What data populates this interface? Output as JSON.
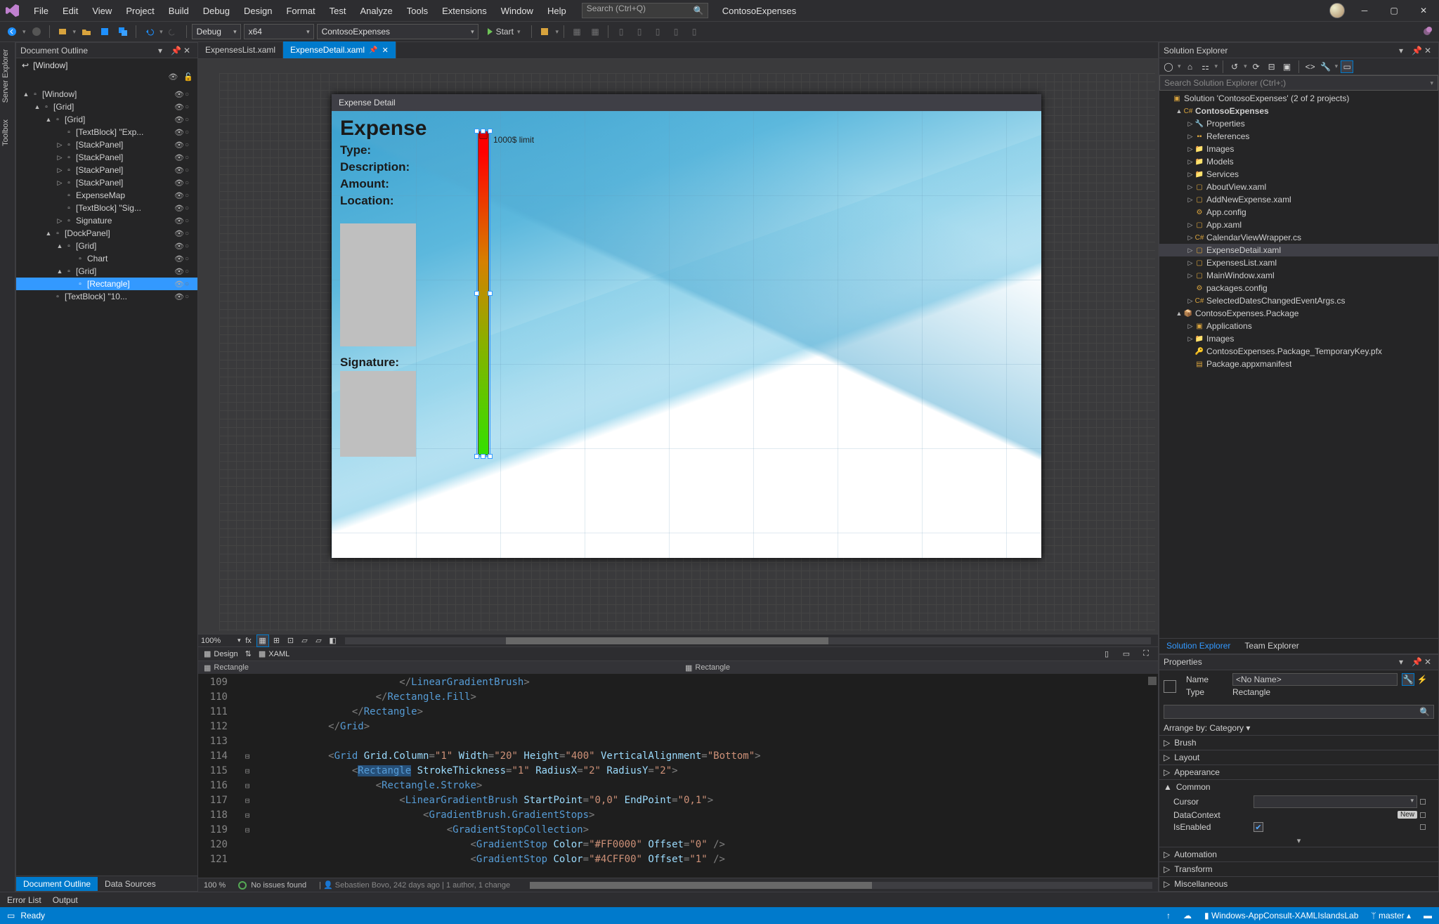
{
  "app": {
    "title": "ContosoExpenses",
    "search_placeholder": "Search (Ctrl+Q)"
  },
  "menu": [
    "File",
    "Edit",
    "View",
    "Project",
    "Build",
    "Debug",
    "Design",
    "Format",
    "Test",
    "Analyze",
    "Tools",
    "Extensions",
    "Window",
    "Help"
  ],
  "toolbar": {
    "config": "Debug",
    "platform": "x64",
    "project": "ContosoExpenses",
    "start": "Start"
  },
  "side_rail": [
    "Server Explorer",
    "Toolbox"
  ],
  "outline": {
    "title": "Document Outline",
    "root_label": "[Window]",
    "nodes": [
      {
        "d": 0,
        "exp": "▲",
        "icon": "win",
        "label": "[Window]"
      },
      {
        "d": 1,
        "exp": "▲",
        "icon": "grid",
        "label": "[Grid]"
      },
      {
        "d": 2,
        "exp": "▲",
        "icon": "grid",
        "label": "[Grid]"
      },
      {
        "d": 3,
        "exp": "",
        "icon": "txt",
        "label": "[TextBlock] \"Exp..."
      },
      {
        "d": 3,
        "exp": "▷",
        "icon": "stack",
        "label": "[StackPanel]"
      },
      {
        "d": 3,
        "exp": "▷",
        "icon": "stack",
        "label": "[StackPanel]"
      },
      {
        "d": 3,
        "exp": "▷",
        "icon": "stack",
        "label": "[StackPanel]"
      },
      {
        "d": 3,
        "exp": "▷",
        "icon": "stack",
        "label": "[StackPanel]"
      },
      {
        "d": 3,
        "exp": "",
        "icon": "map",
        "label": "ExpenseMap"
      },
      {
        "d": 3,
        "exp": "",
        "icon": "txt",
        "label": "[TextBlock] \"Sig..."
      },
      {
        "d": 3,
        "exp": "▷",
        "icon": "ink",
        "label": "Signature"
      },
      {
        "d": 2,
        "exp": "▲",
        "icon": "dock",
        "label": "[DockPanel]"
      },
      {
        "d": 3,
        "exp": "▲",
        "icon": "grid",
        "label": "[Grid]"
      },
      {
        "d": 4,
        "exp": "",
        "icon": "chart",
        "label": "Chart"
      },
      {
        "d": 3,
        "exp": "▲",
        "icon": "grid",
        "label": "[Grid]",
        "sel2": false
      },
      {
        "d": 4,
        "exp": "",
        "icon": "rect",
        "label": "[Rectangle]",
        "selected": true
      },
      {
        "d": 2,
        "exp": "",
        "icon": "txt",
        "label": "[TextBlock] \"10..."
      }
    ]
  },
  "tabs": [
    {
      "label": "ExpensesList.xaml",
      "active": false
    },
    {
      "label": "ExpenseDetail.xaml",
      "active": true,
      "pinned": true
    }
  ],
  "designer": {
    "window_title": "Expense Detail",
    "heading": "Expense",
    "labels": [
      "Type:",
      "Description:",
      "Amount:",
      "Location:"
    ],
    "signature": "Signature:",
    "limit": "1000$ limit",
    "zoom": "100%"
  },
  "modes": {
    "design": "Design",
    "xaml": "XAML"
  },
  "crumb_left": "Rectangle",
  "crumb_right": "Rectangle",
  "code": {
    "start": 109,
    "lines": [
      {
        "n": 109,
        "html": "                        <span class='t-punc'>&lt;/</span><span class='t-tag'>LinearGradientBrush</span><span class='t-punc'>&gt;</span>"
      },
      {
        "n": 110,
        "html": "                    <span class='t-punc'>&lt;/</span><span class='t-tag'>Rectangle.Fill</span><span class='t-punc'>&gt;</span>"
      },
      {
        "n": 111,
        "html": "                <span class='t-punc'>&lt;/</span><span class='t-tag'>Rectangle</span><span class='t-punc'>&gt;</span>"
      },
      {
        "n": 112,
        "html": "            <span class='t-punc'>&lt;/</span><span class='t-tag'>Grid</span><span class='t-punc'>&gt;</span>"
      },
      {
        "n": 113,
        "html": ""
      },
      {
        "n": 114,
        "fold": "⊟",
        "html": "            <span class='t-punc'>&lt;</span><span class='t-tag'>Grid</span> <span class='t-attr'>Grid.Column</span><span class='t-punc'>=</span><span class='t-str'>\"1\"</span> <span class='t-attr'>Width</span><span class='t-punc'>=</span><span class='t-str'>\"20\"</span> <span class='t-attr'>Height</span><span class='t-punc'>=</span><span class='t-str'>\"400\"</span> <span class='t-attr'>VerticalAlignment</span><span class='t-punc'>=</span><span class='t-str'>\"Bottom\"</span><span class='t-punc'>&gt;</span>"
      },
      {
        "n": 115,
        "fold": "⊟",
        "html": "                <span class='t-punc'>&lt;</span><span class='hl'><span class='t-tag'>Rectangle</span></span> <span class='t-attr'>StrokeThickness</span><span class='t-punc'>=</span><span class='t-str'>\"1\"</span> <span class='t-attr'>RadiusX</span><span class='t-punc'>=</span><span class='t-str'>\"2\"</span> <span class='t-attr'>RadiusY</span><span class='t-punc'>=</span><span class='t-str'>\"2\"</span><span class='t-punc'>&gt;</span>"
      },
      {
        "n": 116,
        "fold": "⊟",
        "html": "                    <span class='t-punc'>&lt;</span><span class='t-tag'>Rectangle.Stroke</span><span class='t-punc'>&gt;</span>"
      },
      {
        "n": 117,
        "fold": "⊟",
        "html": "                        <span class='t-punc'>&lt;</span><span class='t-tag'>LinearGradientBrush</span> <span class='t-attr'>StartPoint</span><span class='t-punc'>=</span><span class='t-str'>\"0,0\"</span> <span class='t-attr'>EndPoint</span><span class='t-punc'>=</span><span class='t-str'>\"0,1\"</span><span class='t-punc'>&gt;</span>"
      },
      {
        "n": 118,
        "fold": "⊟",
        "html": "                            <span class='t-punc'>&lt;</span><span class='t-tag'>GradientBrush.GradientStops</span><span class='t-punc'>&gt;</span>"
      },
      {
        "n": 119,
        "fold": "⊟",
        "html": "                                <span class='t-punc'>&lt;</span><span class='t-tag'>GradientStopCollection</span><span class='t-punc'>&gt;</span>"
      },
      {
        "n": 120,
        "html": "                                    <span class='t-punc'>&lt;</span><span class='t-tag'>GradientStop</span> <span class='t-attr'>Color</span><span class='t-punc'>=</span><span class='t-str'>\"#FF0000\"</span> <span class='t-attr'>Offset</span><span class='t-punc'>=</span><span class='t-str'>\"0\"</span> <span class='t-punc'>/&gt;</span>"
      },
      {
        "n": 121,
        "html": "                                    <span class='t-punc'>&lt;</span><span class='t-tag'>GradientStop</span> <span class='t-attr'>Color</span><span class='t-punc'>=</span><span class='t-str'>\"#4CFF00\"</span> <span class='t-attr'>Offset</span><span class='t-punc'>=</span><span class='t-str'>\"1\"</span> <span class='t-punc'>/&gt;</span>"
      }
    ]
  },
  "editor_status": {
    "zoom": "100 %",
    "issues": "No issues found",
    "blame": "Sebastien Bovo, 242 days ago | 1 author, 1 change"
  },
  "bottom_tabs": [
    "Document Outline",
    "Data Sources"
  ],
  "second_bottom": [
    "Error List",
    "Output"
  ],
  "solution": {
    "title": "Solution Explorer",
    "search": "Search Solution Explorer (Ctrl+;)",
    "tree": [
      {
        "d": 0,
        "exp": "",
        "icon": "sln",
        "label": "Solution 'ContosoExpenses' (2 of 2 projects)"
      },
      {
        "d": 1,
        "exp": "▲",
        "icon": "csproj",
        "label": "ContosoExpenses",
        "bold": true
      },
      {
        "d": 2,
        "exp": "▷",
        "icon": "wrench",
        "label": "Properties"
      },
      {
        "d": 2,
        "exp": "▷",
        "icon": "ref",
        "label": "References"
      },
      {
        "d": 2,
        "exp": "▷",
        "icon": "folder",
        "label": "Images"
      },
      {
        "d": 2,
        "exp": "▷",
        "icon": "folder",
        "label": "Models"
      },
      {
        "d": 2,
        "exp": "▷",
        "icon": "folder",
        "label": "Services"
      },
      {
        "d": 2,
        "exp": "▷",
        "icon": "xaml",
        "label": "AboutView.xaml"
      },
      {
        "d": 2,
        "exp": "▷",
        "icon": "xaml",
        "label": "AddNewExpense.xaml"
      },
      {
        "d": 2,
        "exp": "",
        "icon": "cfg",
        "label": "App.config"
      },
      {
        "d": 2,
        "exp": "▷",
        "icon": "xaml",
        "label": "App.xaml"
      },
      {
        "d": 2,
        "exp": "▷",
        "icon": "cs",
        "label": "CalendarViewWrapper.cs"
      },
      {
        "d": 2,
        "exp": "▷",
        "icon": "xaml",
        "label": "ExpenseDetail.xaml",
        "sel": true
      },
      {
        "d": 2,
        "exp": "▷",
        "icon": "xaml",
        "label": "ExpensesList.xaml"
      },
      {
        "d": 2,
        "exp": "▷",
        "icon": "xaml",
        "label": "MainWindow.xaml"
      },
      {
        "d": 2,
        "exp": "",
        "icon": "cfg",
        "label": "packages.config"
      },
      {
        "d": 2,
        "exp": "▷",
        "icon": "cs",
        "label": "SelectedDatesChangedEventArgs.cs"
      },
      {
        "d": 1,
        "exp": "▲",
        "icon": "pkg",
        "label": "ContosoExpenses.Package"
      },
      {
        "d": 2,
        "exp": "▷",
        "icon": "apps",
        "label": "Applications"
      },
      {
        "d": 2,
        "exp": "▷",
        "icon": "folder",
        "label": "Images"
      },
      {
        "d": 2,
        "exp": "",
        "icon": "key",
        "label": "ContosoExpenses.Package_TemporaryKey.pfx"
      },
      {
        "d": 2,
        "exp": "",
        "icon": "manifest",
        "label": "Package.appxmanifest"
      }
    ],
    "lower_tabs": [
      "Solution Explorer",
      "Team Explorer"
    ]
  },
  "properties": {
    "title": "Properties",
    "name_label": "Name",
    "name_value": "<No Name>",
    "type_label": "Type",
    "type_value": "Rectangle",
    "arrange": "Arrange by: Category ",
    "cats_collapsed": [
      "Brush",
      "Layout",
      "Appearance"
    ],
    "common": {
      "title": "Common",
      "cursor": "Cursor",
      "datacontext": "DataContext",
      "datacontext_badge": "New",
      "isenabled": "IsEnabled"
    },
    "cats_after": [
      "Automation",
      "Transform",
      "Miscellaneous"
    ]
  },
  "status": {
    "ready": "Ready",
    "pub": "Windows-AppConsult-XAMLIslandsLab",
    "branch": "master"
  }
}
